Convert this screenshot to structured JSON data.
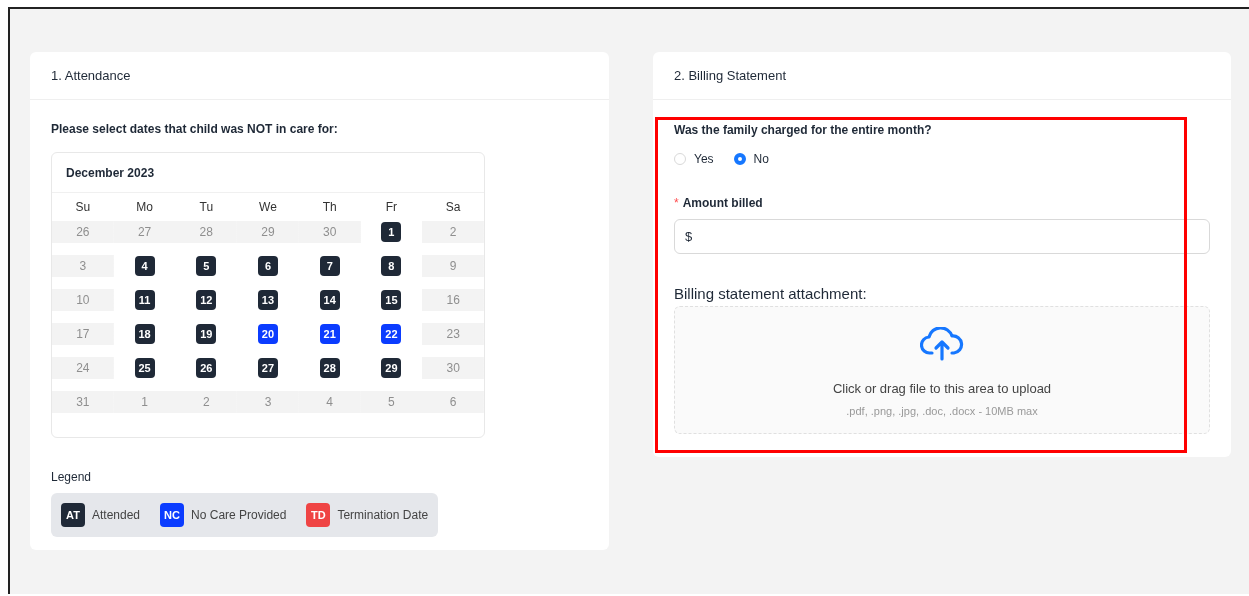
{
  "attendance": {
    "title": "1. Attendance",
    "prompt": "Please select dates that child was NOT in care for:",
    "calendar": {
      "month": "December 2023",
      "weekdays": [
        "Su",
        "Mo",
        "Tu",
        "We",
        "Th",
        "Fr",
        "Sa"
      ],
      "weeks": [
        [
          {
            "label": "26",
            "kind": "unavailable"
          },
          {
            "label": "27",
            "kind": "unavailable"
          },
          {
            "label": "28",
            "kind": "unavailable"
          },
          {
            "label": "29",
            "kind": "unavailable"
          },
          {
            "label": "30",
            "kind": "unavailable"
          },
          {
            "label": "1",
            "kind": "attended"
          },
          {
            "label": "2",
            "kind": "unavailable"
          }
        ],
        [
          {
            "label": "3",
            "kind": "unavailable"
          },
          {
            "label": "4",
            "kind": "attended"
          },
          {
            "label": "5",
            "kind": "attended"
          },
          {
            "label": "6",
            "kind": "attended"
          },
          {
            "label": "7",
            "kind": "attended"
          },
          {
            "label": "8",
            "kind": "attended"
          },
          {
            "label": "9",
            "kind": "unavailable"
          }
        ],
        [
          {
            "label": "10",
            "kind": "unavailable"
          },
          {
            "label": "11",
            "kind": "attended"
          },
          {
            "label": "12",
            "kind": "attended"
          },
          {
            "label": "13",
            "kind": "attended"
          },
          {
            "label": "14",
            "kind": "attended"
          },
          {
            "label": "15",
            "kind": "attended"
          },
          {
            "label": "16",
            "kind": "unavailable"
          }
        ],
        [
          {
            "label": "17",
            "kind": "unavailable"
          },
          {
            "label": "18",
            "kind": "attended"
          },
          {
            "label": "19",
            "kind": "attended"
          },
          {
            "label": "20",
            "kind": "no_care"
          },
          {
            "label": "21",
            "kind": "no_care"
          },
          {
            "label": "22",
            "kind": "no_care"
          },
          {
            "label": "23",
            "kind": "unavailable"
          }
        ],
        [
          {
            "label": "24",
            "kind": "unavailable"
          },
          {
            "label": "25",
            "kind": "attended"
          },
          {
            "label": "26",
            "kind": "attended"
          },
          {
            "label": "27",
            "kind": "attended"
          },
          {
            "label": "28",
            "kind": "attended"
          },
          {
            "label": "29",
            "kind": "attended"
          },
          {
            "label": "30",
            "kind": "unavailable"
          }
        ],
        [
          {
            "label": "31",
            "kind": "unavailable"
          },
          {
            "label": "1",
            "kind": "unavailable"
          },
          {
            "label": "2",
            "kind": "unavailable"
          },
          {
            "label": "3",
            "kind": "unavailable"
          },
          {
            "label": "4",
            "kind": "unavailable"
          },
          {
            "label": "5",
            "kind": "unavailable"
          },
          {
            "label": "6",
            "kind": "unavailable"
          }
        ]
      ]
    },
    "legend": {
      "title": "Legend",
      "items": [
        {
          "code": "AT",
          "label": "Attended",
          "color": "#1f2937"
        },
        {
          "code": "NC",
          "label": "No Care Provided",
          "color": "#0b3cff"
        },
        {
          "code": "TD",
          "label": "Termination Date",
          "color": "#ef4444"
        }
      ]
    }
  },
  "billing": {
    "title": "2. Billing Statement",
    "question": "Was the family charged for the entire month?",
    "options": [
      {
        "label": "Yes",
        "selected": false
      },
      {
        "label": "No",
        "selected": true
      }
    ],
    "amount": {
      "required_mark": "*",
      "label": "Amount billed",
      "prefix": "$"
    },
    "attachment": {
      "label": "Billing statement attachment:",
      "hint": "Click or drag file to this area to upload",
      "formats": ".pdf, .png, .jpg, .doc, .docx - 10MB max"
    }
  }
}
